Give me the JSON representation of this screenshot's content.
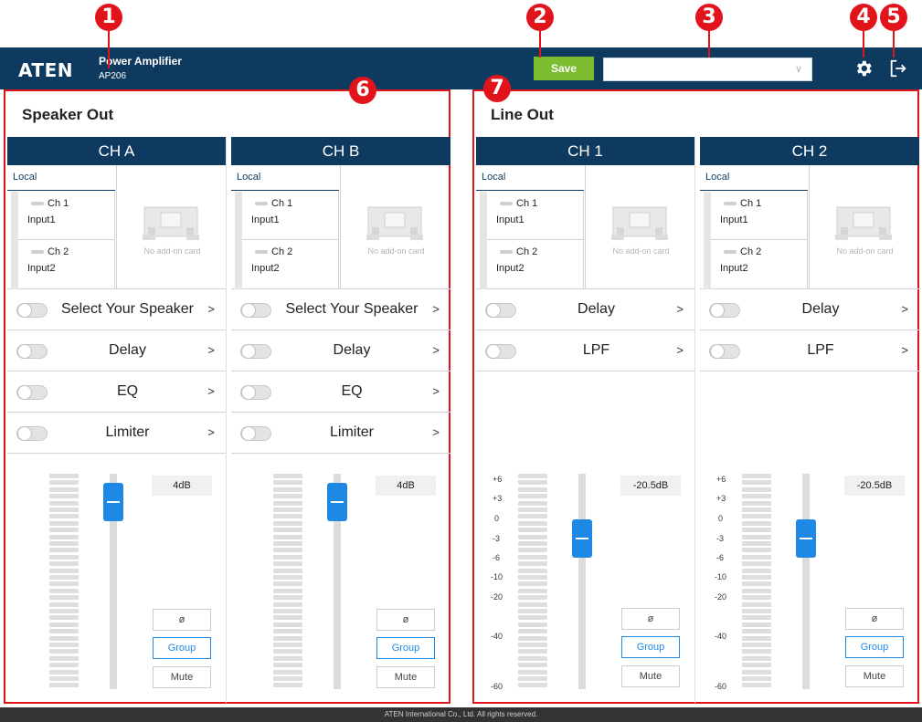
{
  "callouts": [
    "1",
    "2",
    "3",
    "4",
    "5",
    "6",
    "7"
  ],
  "header": {
    "logo": "ATEN",
    "product_name": "Power Amplifier",
    "model": "AP206",
    "save_label": "Save",
    "preset_value": "",
    "icons": {
      "settings": "gear-icon",
      "logout": "logout-icon",
      "dropdown": "chevron-down-icon"
    }
  },
  "speaker_out": {
    "title": "Speaker Out",
    "channels": [
      {
        "name": "CH A",
        "source_tab": "Local",
        "sources": [
          {
            "ch": "Ch 1",
            "input": "Input1"
          },
          {
            "ch": "Ch 2",
            "input": "Input2"
          }
        ],
        "card_caption": "No add-on card",
        "features": [
          "Select Your Speaker",
          "Delay",
          "EQ",
          "Limiter"
        ],
        "level": "4dB",
        "buttons": [
          "ø",
          "Group",
          "Mute"
        ]
      },
      {
        "name": "CH B",
        "source_tab": "Local",
        "sources": [
          {
            "ch": "Ch 1",
            "input": "Input1"
          },
          {
            "ch": "Ch 2",
            "input": "Input2"
          }
        ],
        "card_caption": "No add-on card",
        "features": [
          "Select Your Speaker",
          "Delay",
          "EQ",
          "Limiter"
        ],
        "level": "4dB",
        "buttons": [
          "ø",
          "Group",
          "Mute"
        ]
      }
    ]
  },
  "line_out": {
    "title": "Line Out",
    "meter_scale": [
      "+6",
      "+3",
      "0",
      "-3",
      "-6",
      "-10",
      "-20",
      "-40",
      "-60"
    ],
    "channels": [
      {
        "name": "CH 1",
        "source_tab": "Local",
        "sources": [
          {
            "ch": "Ch 1",
            "input": "Input1"
          },
          {
            "ch": "Ch 2",
            "input": "Input2"
          }
        ],
        "card_caption": "No add-on card",
        "features": [
          "Delay",
          "LPF"
        ],
        "level": "-20.5dB",
        "buttons": [
          "ø",
          "Group",
          "Mute"
        ]
      },
      {
        "name": "CH 2",
        "source_tab": "Local",
        "sources": [
          {
            "ch": "Ch 1",
            "input": "Input1"
          },
          {
            "ch": "Ch 2",
            "input": "Input2"
          }
        ],
        "card_caption": "No add-on card",
        "features": [
          "Delay",
          "LPF"
        ],
        "level": "-20.5dB",
        "buttons": [
          "ø",
          "Group",
          "Mute"
        ]
      }
    ]
  },
  "footer": {
    "text": "ATEN International Co., Ltd. All rights reserved."
  },
  "colors": {
    "header_bg": "#0f3a5f",
    "save_green": "#7bbd2f",
    "fader_blue": "#1e88e5",
    "callout_red": "#e1141b"
  }
}
